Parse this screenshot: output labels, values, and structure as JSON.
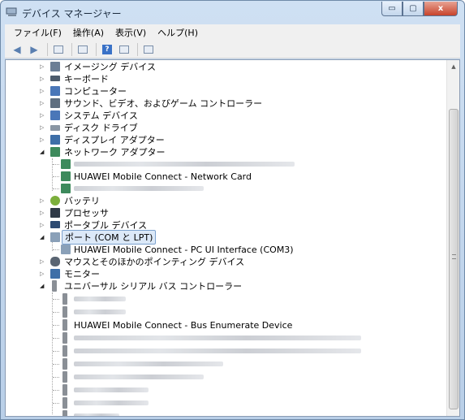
{
  "window": {
    "title": "デバイス マネージャー",
    "controls": {
      "minimize": "▭",
      "maximize": "▢",
      "close": "x"
    }
  },
  "menu": [
    {
      "label": "ファイル(F)"
    },
    {
      "label": "操作(A)"
    },
    {
      "label": "表示(V)"
    },
    {
      "label": "ヘルプ(H)"
    }
  ],
  "toolbar": {
    "back_icon": "arrow-back-icon",
    "forward_icon": "arrow-forward-icon",
    "help_glyph": "?"
  },
  "tree": {
    "categories": {
      "imaging": "イメージング デバイス",
      "keyboard": "キーボード",
      "computer": "コンピューター",
      "sound": "サウンド、ビデオ、およびゲーム コントローラー",
      "system": "システム デバイス",
      "disk": "ディスク ドライブ",
      "display": "ディスプレイ アダプター",
      "network": "ネットワーク アダプター",
      "battery": "バッテリ",
      "processor": "プロセッサ",
      "portable": "ポータブル デバイス",
      "ports": "ポート (COM と LPT)",
      "mouse": "マウスとそのほかのポインティング デバイス",
      "monitor": "モニター",
      "usb": "ユニバーサル シリアル バス コントローラー"
    },
    "network_devices": {
      "huawei_network_card": "HUAWEI Mobile Connect - Network Card"
    },
    "port_devices": {
      "huawei_pc_ui": "HUAWEI Mobile Connect - PC UI Interface (COM3)"
    },
    "usb_devices": {
      "huawei_bus_enum": "HUAWEI Mobile Connect - Bus Enumerate Device"
    }
  },
  "colors": {
    "selection": "#dce9f8",
    "selection_border": "#7da2ce",
    "titlebar": "#cfe0f3"
  }
}
